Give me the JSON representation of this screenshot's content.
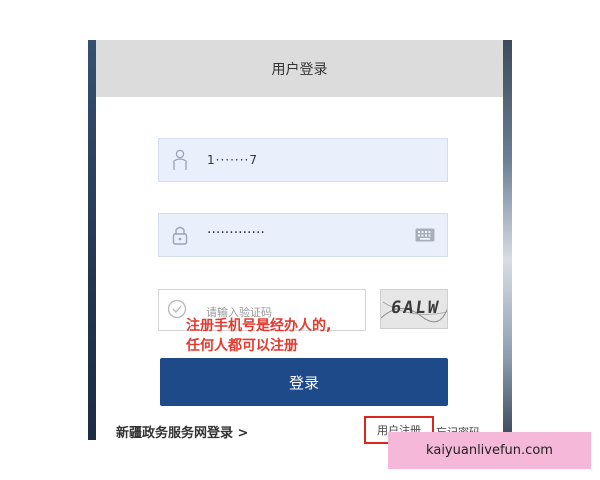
{
  "dialog": {
    "title": "用户登录"
  },
  "username": {
    "value": "1·······7",
    "icon": "user-icon"
  },
  "password": {
    "value": "·············",
    "icon": "lock-icon",
    "keyboard_icon": "keyboard-icon"
  },
  "captcha": {
    "placeholder": "请输入验证码",
    "icon": "check-circle-icon",
    "image_text": "6ALW"
  },
  "annotation": {
    "line1": "注册手机号是经办人的,",
    "line2": "任何人都可以注册"
  },
  "login_button": {
    "label": "登录"
  },
  "links": {
    "portal": "新疆政务服务网登录 >",
    "register": "用户注册",
    "forgot": "忘记密码"
  },
  "watermark": {
    "text": "kaiyuanlivefun.com"
  },
  "colors": {
    "primary_button": "#1f4a8a",
    "annotation_red": "#e23a2f",
    "input_bg": "#eaf0fb",
    "header_bg": "#dcdcdc",
    "watermark_bg": "#f5b8d8"
  }
}
